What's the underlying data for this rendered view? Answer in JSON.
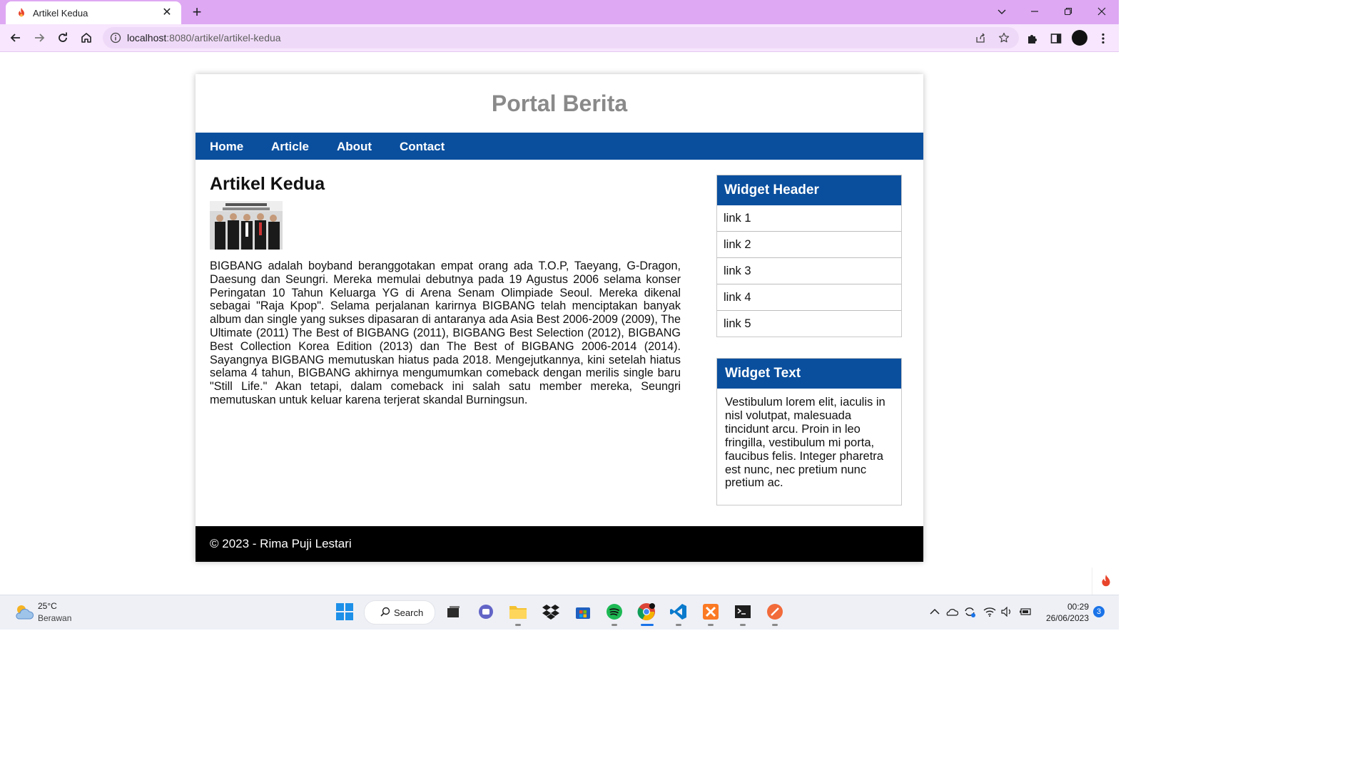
{
  "browser": {
    "tab_title": "Artikel Kedua",
    "tab_close": "✕",
    "new_tab": "+",
    "url_host": "localhost",
    "url_path": ":8080/artikel/artikel-kedua"
  },
  "site": {
    "title": "Portal Berita",
    "nav": [
      "Home",
      "Article",
      "About",
      "Contact"
    ]
  },
  "article": {
    "heading": "Artikel Kedua",
    "body": "BIGBANG adalah boyband beranggotakan empat orang ada T.O.P, Taeyang, G-Dragon, Daesung dan Seungri. Mereka memulai debutnya pada 19 Agustus 2006 selama konser Peringatan 10 Tahun Keluarga YG di Arena Senam Olimpiade Seoul. Mereka dikenal sebagai \"Raja Kpop\". Selama perjalanan karirnya BIGBANG telah menciptakan banyak album dan single yang sukses dipasaran di antaranya ada Asia Best 2006-2009 (2009), The Ultimate (2011) The Best of BIGBANG (2011), BIGBANG Best Selection (2012), BIGBANG Best Collection Korea Edition (2013) dan The Best of BIGBANG 2006-2014 (2014). Sayangnya BIGBANG memutuskan hiatus pada 2018. Mengejutkannya, kini setelah hiatus selama 4 tahun, BIGBANG akhirnya mengumumkan comeback dengan merilis single baru \"Still Life.\" Akan tetapi, dalam comeback ini salah satu member mereka, Seungri memutuskan untuk keluar karena terjerat skandal Burningsun."
  },
  "widgets": {
    "links_header": "Widget Header",
    "links": [
      "link 1",
      "link 2",
      "link 3",
      "link 4",
      "link 5"
    ],
    "text_header": "Widget Text",
    "text": "Vestibulum lorem elit, iaculis in nisl volutpat, malesuada tincidunt arcu. Proin in leo fringilla, vestibulum mi porta, faucibus felis. Integer pharetra est nunc, nec pretium nunc pretium ac."
  },
  "footer": {
    "text": "© 2023 - Rima Puji Lestari"
  },
  "taskbar": {
    "temperature": "25°C",
    "weather": "Berawan",
    "search_label": "Search",
    "time": "00:29",
    "date": "26/06/2023",
    "notification_count": "3"
  },
  "colors": {
    "browser_frame": "#dea8f3",
    "nav_blue": "#0a4f9e",
    "footer": "#000000",
    "site_title": "#8a8a8a"
  },
  "icons": [
    "fire-favicon-icon",
    "close-icon",
    "plus-icon",
    "chevron-down-icon",
    "minimize-icon",
    "restore-icon",
    "back-icon",
    "forward-icon",
    "reload-icon",
    "home-icon",
    "info-icon",
    "share-icon",
    "star-icon",
    "extensions-icon",
    "sidepanel-icon",
    "kebab-menu-icon",
    "weather-icon",
    "windows-start-icon",
    "search-icon",
    "task-view-icon",
    "teams-icon",
    "file-explorer-icon",
    "dropbox-icon",
    "store-icon",
    "spotify-icon",
    "chrome-icon",
    "vscode-icon",
    "xampp-icon",
    "terminal-icon",
    "app-icon",
    "chevron-up-icon",
    "onedrive-icon",
    "sync-icon",
    "wifi-icon",
    "volume-icon",
    "battery-icon"
  ]
}
